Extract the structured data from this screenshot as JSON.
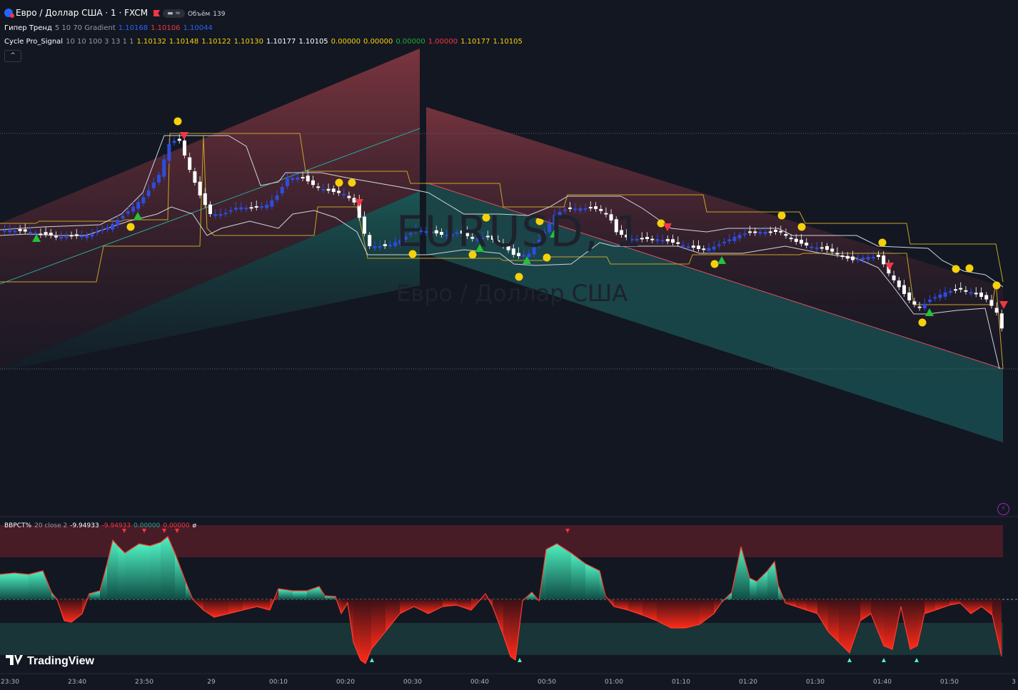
{
  "header": {
    "symbol_title": "Евро / Доллар США · 1 · FXCM",
    "volume_label": "Объём",
    "volume_value": "139",
    "pill_text": "▬ ≈"
  },
  "indicators": {
    "hyper_trend": {
      "name": "Гипер Тренд",
      "params": "5 10 70 Gradient",
      "v1": "1.10168",
      "v2": "1.10106",
      "v3": "1.10044"
    },
    "cycle_pro": {
      "name": "Cycle Pro_Signal",
      "params": "10 10 100 3 13 1 1",
      "values": [
        {
          "text": "1.10132",
          "cls": "yel"
        },
        {
          "text": "1.10148",
          "cls": "yel"
        },
        {
          "text": "1.10122",
          "cls": "yel"
        },
        {
          "text": "1.10130",
          "cls": "yel"
        },
        {
          "text": "1.10177",
          "cls": "wht"
        },
        {
          "text": "1.10105",
          "cls": "wht"
        },
        {
          "text": "0.00000",
          "cls": "yel"
        },
        {
          "text": "0.00000",
          "cls": "yel"
        },
        {
          "text": "0.00000",
          "cls": "grn"
        },
        {
          "text": "1.00000",
          "cls": "red"
        },
        {
          "text": "1.10177",
          "cls": "yel"
        },
        {
          "text": "1.10105",
          "cls": "yel"
        }
      ]
    },
    "bbpct": {
      "name": "BBPCT%",
      "params": "20 close 2",
      "v1": "-9.94933",
      "v2": "-9.94933",
      "v3": "0.00000",
      "v4": "0.00000",
      "v5": "ø"
    }
  },
  "watermark": {
    "symbol": "EURUSD, 1",
    "name": "Евро / Доллар США"
  },
  "brand": {
    "name": "TradingView"
  },
  "collapse_icon": "^",
  "time_ticks": [
    "23:30",
    "23:40",
    "23:50",
    "29",
    "00:10",
    "00:20",
    "00:30",
    "00:40",
    "00:50",
    "01:00",
    "01:10",
    "01:20",
    "01:30",
    "01:40",
    "01:50",
    "3"
  ],
  "colors": {
    "bg": "#131722",
    "up": "#2e4cdf",
    "down": "#ffffff",
    "signal_red": "#f23645",
    "signal_green": "#22c33a",
    "dot_yellow": "#f5d10b",
    "band_gold": "#c9a227",
    "teal": "#26a69a",
    "maroon": "#7b2a36"
  }
}
